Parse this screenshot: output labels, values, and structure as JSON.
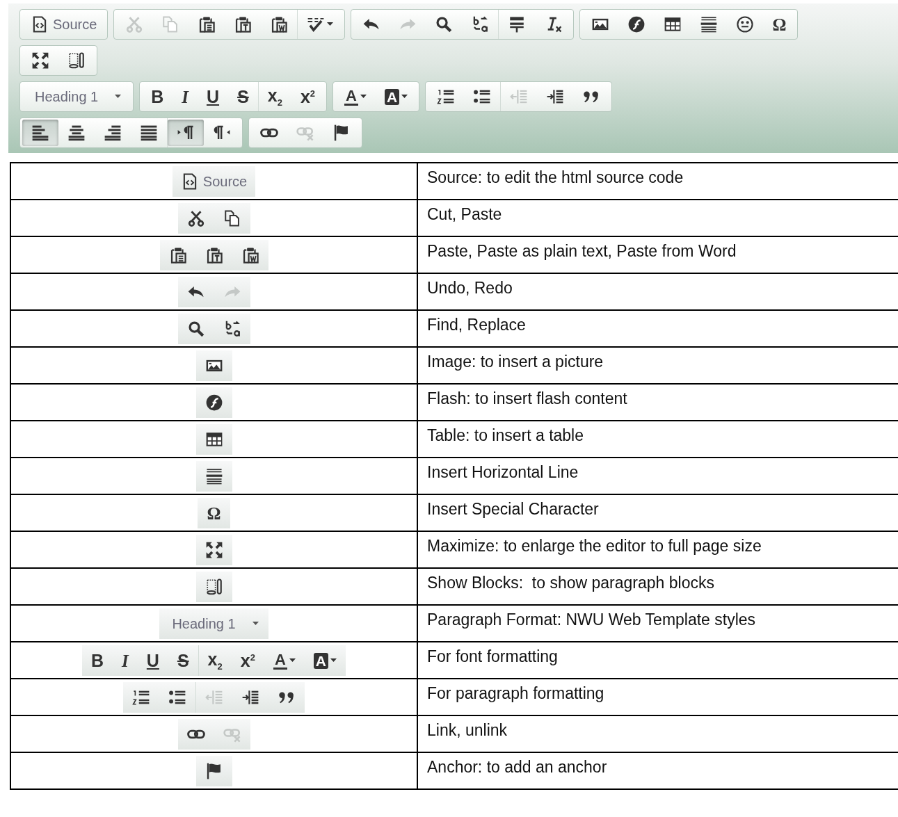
{
  "toolbar": {
    "rows": [
      [
        {
          "sections": [
            [
              {
                "kind": "source",
                "label": "Source",
                "disabled": false
              }
            ]
          ]
        },
        {
          "sections": [
            [
              {
                "kind": "cut",
                "disabled": true
              },
              {
                "kind": "copy",
                "disabled": true
              },
              {
                "kind": "paste",
                "disabled": false
              },
              {
                "kind": "pastetext",
                "disabled": false
              },
              {
                "kind": "pasteword",
                "disabled": false
              }
            ],
            [
              {
                "kind": "spellcheck",
                "disabled": false
              }
            ]
          ]
        },
        {
          "sections": [
            [
              {
                "kind": "undo",
                "disabled": false
              },
              {
                "kind": "redo",
                "disabled": true
              },
              {
                "kind": "find",
                "disabled": false
              },
              {
                "kind": "replace",
                "disabled": false
              }
            ],
            [
              {
                "kind": "pagebreak",
                "disabled": false
              },
              {
                "kind": "removeformat",
                "disabled": false
              }
            ]
          ]
        },
        {
          "sections": [
            [
              {
                "kind": "image",
                "disabled": false
              },
              {
                "kind": "flash",
                "disabled": false
              },
              {
                "kind": "table",
                "disabled": false
              },
              {
                "kind": "hline",
                "disabled": false
              },
              {
                "kind": "smiley",
                "disabled": false
              },
              {
                "kind": "special",
                "text": "Ω",
                "disabled": false
              }
            ]
          ]
        }
      ],
      [
        {
          "sections": [
            [
              {
                "kind": "maximize",
                "disabled": false
              },
              {
                "kind": "showblocks",
                "disabled": false
              }
            ]
          ]
        }
      ],
      [
        {
          "sections": [
            [
              {
                "kind": "format",
                "label": "Heading 1",
                "disabled": false
              }
            ]
          ]
        },
        {
          "sections": [
            [
              {
                "kind": "bold",
                "text": "B",
                "disabled": false
              },
              {
                "kind": "italic",
                "text": "I",
                "disabled": false
              },
              {
                "kind": "underline",
                "text": "U",
                "disabled": false
              },
              {
                "kind": "strike",
                "text": "S",
                "disabled": false
              }
            ],
            [
              {
                "kind": "sub",
                "text": "x$_{2}$",
                "disabled": false
              },
              {
                "kind": "sup",
                "text": "x$^{2}$",
                "disabled": false
              }
            ]
          ]
        },
        {
          "sections": [
            [
              {
                "kind": "textcolor",
                "text": "A",
                "disabled": false
              },
              {
                "kind": "bgcolor",
                "text": "A",
                "disabled": false
              }
            ]
          ]
        },
        {
          "sections": [
            [
              {
                "kind": "numlist",
                "disabled": false
              },
              {
                "kind": "bulletlist",
                "disabled": false
              }
            ],
            [
              {
                "kind": "outdent",
                "disabled": true
              },
              {
                "kind": "indent",
                "disabled": false
              },
              {
                "kind": "blockquote",
                "disabled": false
              }
            ]
          ]
        }
      ],
      [
        {
          "sections": [
            [
              {
                "kind": "alignleft",
                "disabled": false,
                "selected": true
              },
              {
                "kind": "aligncenter",
                "disabled": false,
                "selected": false
              },
              {
                "kind": "alignright",
                "disabled": false,
                "selected": false
              },
              {
                "kind": "justify",
                "disabled": false,
                "selected": false
              }
            ],
            [
              {
                "kind": "ltr",
                "disabled": false,
                "selected": true
              },
              {
                "kind": "rtl",
                "disabled": false,
                "selected": false
              }
            ]
          ]
        },
        {
          "sections": [
            [
              {
                "kind": "link",
                "disabled": false
              },
              {
                "kind": "unlink",
                "disabled": true
              },
              {
                "kind": "anchor",
                "disabled": false
              }
            ]
          ]
        }
      ]
    ]
  },
  "table": {
    "rows": [
      {
        "strips": [
          [
            [
              {
                "kind": "source",
                "label": "Source",
                "disabled": false
              }
            ]
          ]
        ],
        "description": "Source: to edit the html source code"
      },
      {
        "strips": [
          [
            [
              {
                "kind": "cut",
                "disabled": false
              },
              {
                "kind": "copy",
                "disabled": false
              }
            ]
          ]
        ],
        "description": "Cut, Paste"
      },
      {
        "strips": [
          [
            [
              {
                "kind": "paste",
                "disabled": false
              },
              {
                "kind": "pastetext",
                "disabled": false
              },
              {
                "kind": "pasteword",
                "disabled": false
              }
            ]
          ]
        ],
        "description": "Paste, Paste as plain text, Paste from Word"
      },
      {
        "strips": [
          [
            [
              {
                "kind": "undo",
                "disabled": false
              },
              {
                "kind": "redo",
                "disabled": true
              }
            ]
          ]
        ],
        "description": "Undo, Redo"
      },
      {
        "strips": [
          [
            [
              {
                "kind": "find",
                "disabled": false
              },
              {
                "kind": "replace",
                "disabled": false
              }
            ]
          ]
        ],
        "description": "Find, Replace"
      },
      {
        "strips": [
          [
            [
              {
                "kind": "image",
                "disabled": false
              }
            ]
          ]
        ],
        "description": "Image: to insert a picture"
      },
      {
        "strips": [
          [
            [
              {
                "kind": "flash",
                "disabled": false
              }
            ]
          ]
        ],
        "description": "Flash: to insert flash content"
      },
      {
        "strips": [
          [
            [
              {
                "kind": "table",
                "disabled": false
              }
            ]
          ]
        ],
        "description": "Table: to insert a table"
      },
      {
        "strips": [
          [
            [
              {
                "kind": "hline",
                "disabled": false
              }
            ]
          ]
        ],
        "description": "Insert Horizontal Line"
      },
      {
        "strips": [
          [
            [
              {
                "kind": "special",
                "text": "Ω",
                "disabled": false
              }
            ]
          ]
        ],
        "description": "Insert Special Character"
      },
      {
        "strips": [
          [
            [
              {
                "kind": "maximize",
                "disabled": false
              }
            ]
          ]
        ],
        "description": "Maximize: to enlarge the editor to full page size"
      },
      {
        "strips": [
          [
            [
              {
                "kind": "showblocks",
                "disabled": false
              }
            ]
          ]
        ],
        "description": "Show Blocks:  to show paragraph blocks"
      },
      {
        "strips": [
          [
            [
              {
                "kind": "format",
                "label": "Heading 1",
                "disabled": false
              }
            ]
          ]
        ],
        "description": "Paragraph Format: NWU Web Template styles"
      },
      {
        "strips": [
          [
            [
              {
                "kind": "bold",
                "text": "B",
                "disabled": false
              },
              {
                "kind": "italic",
                "text": "I",
                "disabled": false
              },
              {
                "kind": "underline",
                "text": "U",
                "disabled": false
              },
              {
                "kind": "strike",
                "text": "S",
                "disabled": false
              }
            ],
            [
              {
                "kind": "sub",
                "text": "x$_{2}$",
                "disabled": false
              },
              {
                "kind": "sup",
                "text": "x$^{2}$",
                "disabled": false
              }
            ]
          ],
          [
            [
              {
                "kind": "textcolor",
                "text": "A",
                "disabled": false
              },
              {
                "kind": "bgcolor",
                "text": "A",
                "disabled": false
              }
            ]
          ]
        ],
        "description": "For font formatting"
      },
      {
        "strips": [
          [
            [
              {
                "kind": "numlist",
                "disabled": false
              },
              {
                "kind": "bulletlist",
                "disabled": false
              }
            ],
            [
              {
                "kind": "outdent",
                "disabled": true
              },
              {
                "kind": "indent",
                "disabled": false
              },
              {
                "kind": "blockquote",
                "disabled": false
              }
            ]
          ]
        ],
        "description": "For paragraph formatting"
      },
      {
        "strips": [
          [
            [
              {
                "kind": "link",
                "disabled": false
              },
              {
                "kind": "unlink",
                "disabled": true
              }
            ]
          ]
        ],
        "description": "Link, unlink"
      },
      {
        "strips": [
          [
            [
              {
                "kind": "anchor",
                "disabled": false
              }
            ]
          ]
        ],
        "description": "Anchor: to add an anchor"
      }
    ]
  }
}
